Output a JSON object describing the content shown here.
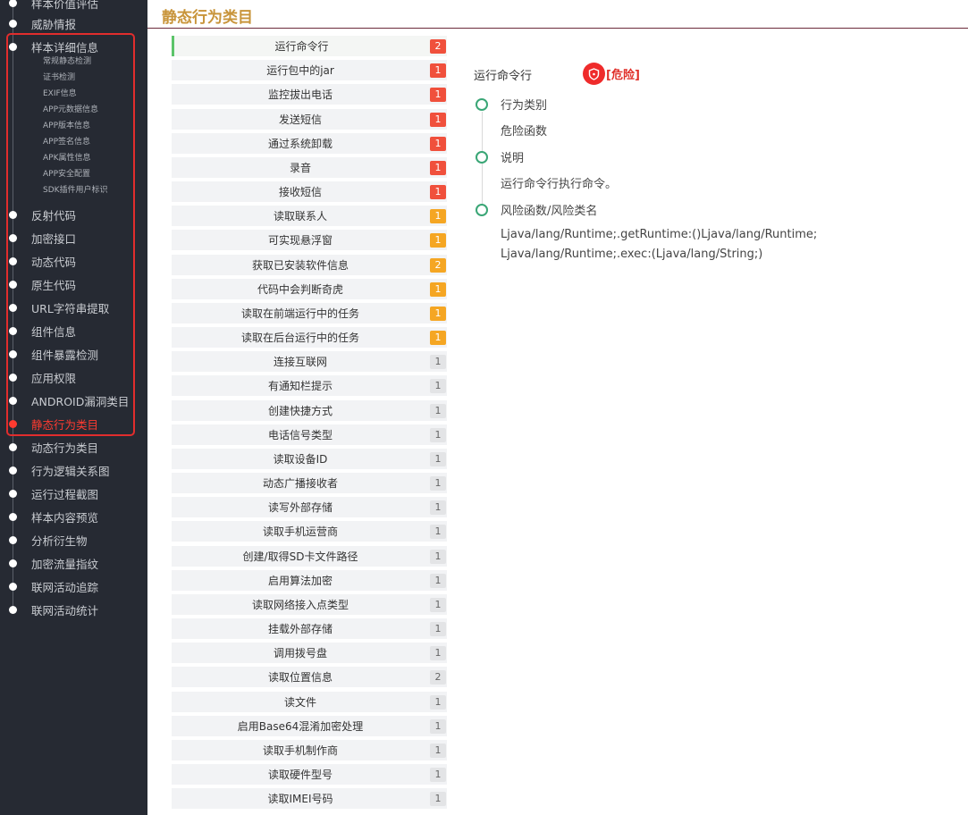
{
  "sidebar": {
    "items_top": [
      {
        "label": "样本价值评估"
      },
      {
        "label": "威胁情报"
      }
    ],
    "detail_group": {
      "label": "样本详细信息",
      "sub_items": [
        "常规静态检测",
        "证书检测",
        "EXIF信息",
        "APP元数据信息",
        "APP版本信息",
        "APP签名信息",
        "APK属性信息",
        "APP安全配置",
        "SDK插件用户标识"
      ]
    },
    "items_mid": [
      {
        "label": "反射代码"
      },
      {
        "label": "加密接口"
      },
      {
        "label": "动态代码"
      },
      {
        "label": "原生代码"
      },
      {
        "label": "URL字符串提取"
      },
      {
        "label": "组件信息"
      },
      {
        "label": "组件暴露检测"
      },
      {
        "label": "应用权限"
      },
      {
        "label": "ANDROID漏洞类目"
      },
      {
        "label": "静态行为类目"
      }
    ],
    "items_bottom": [
      {
        "label": "动态行为类目"
      },
      {
        "label": "行为逻辑关系图"
      },
      {
        "label": "运行过程截图"
      },
      {
        "label": "样本内容预览"
      },
      {
        "label": "分析衍生物"
      },
      {
        "label": "加密流量指纹"
      },
      {
        "label": "联网活动追踪"
      },
      {
        "label": "联网活动统计"
      }
    ],
    "active_label": "静态行为类目"
  },
  "page": {
    "title": "静态行为类目"
  },
  "categories": [
    {
      "label": "运行命令行",
      "count": "2",
      "level": "red"
    },
    {
      "label": "运行包中的jar",
      "count": "1",
      "level": "red"
    },
    {
      "label": "监控拔出电话",
      "count": "1",
      "level": "red"
    },
    {
      "label": "发送短信",
      "count": "1",
      "level": "red"
    },
    {
      "label": "通过系统卸载",
      "count": "1",
      "level": "red"
    },
    {
      "label": "录音",
      "count": "1",
      "level": "red"
    },
    {
      "label": "接收短信",
      "count": "1",
      "level": "red"
    },
    {
      "label": "读取联系人",
      "count": "1",
      "level": "orange"
    },
    {
      "label": "可实现悬浮窗",
      "count": "1",
      "level": "orange"
    },
    {
      "label": "获取已安装软件信息",
      "count": "2",
      "level": "orange"
    },
    {
      "label": "代码中会判断奇虎",
      "count": "1",
      "level": "orange"
    },
    {
      "label": "读取在前端运行中的任务",
      "count": "1",
      "level": "orange"
    },
    {
      "label": "读取在后台运行中的任务",
      "count": "1",
      "level": "orange"
    },
    {
      "label": "连接互联网",
      "count": "1",
      "level": "grey"
    },
    {
      "label": "有通知栏提示",
      "count": "1",
      "level": "grey"
    },
    {
      "label": "创建快捷方式",
      "count": "1",
      "level": "grey"
    },
    {
      "label": "电话信号类型",
      "count": "1",
      "level": "grey"
    },
    {
      "label": "读取设备ID",
      "count": "1",
      "level": "grey"
    },
    {
      "label": "动态广播接收者",
      "count": "1",
      "level": "grey"
    },
    {
      "label": "读写外部存储",
      "count": "1",
      "level": "grey"
    },
    {
      "label": "读取手机运营商",
      "count": "1",
      "level": "grey"
    },
    {
      "label": "创建/取得SD卡文件路径",
      "count": "1",
      "level": "grey"
    },
    {
      "label": "启用算法加密",
      "count": "1",
      "level": "grey"
    },
    {
      "label": "读取网络接入点类型",
      "count": "1",
      "level": "grey"
    },
    {
      "label": "挂载外部存储",
      "count": "1",
      "level": "grey"
    },
    {
      "label": "调用拨号盘",
      "count": "1",
      "level": "grey"
    },
    {
      "label": "读取位置信息",
      "count": "2",
      "level": "grey"
    },
    {
      "label": "读文件",
      "count": "1",
      "level": "grey"
    },
    {
      "label": "启用Base64混淆加密处理",
      "count": "1",
      "level": "grey"
    },
    {
      "label": "读取手机制作商",
      "count": "1",
      "level": "grey"
    },
    {
      "label": "读取硬件型号",
      "count": "1",
      "level": "grey"
    },
    {
      "label": "读取IMEI号码",
      "count": "1",
      "level": "grey"
    }
  ],
  "detail": {
    "title": "运行命令行",
    "danger_label": "[危险]",
    "fields": [
      {
        "heading": "行为类别",
        "value": "危险函数"
      },
      {
        "heading": "说明",
        "value": "运行命令行执行命令。"
      },
      {
        "heading": "风险函数/风险类名",
        "value_lines": [
          "Ljava/lang/Runtime;.getRuntime:()Ljava/lang/Runtime;",
          "Ljava/lang/Runtime;.exec:(Ljava/lang/String;)"
        ]
      }
    ]
  },
  "colors": {
    "sidebar_bg": "#262a33",
    "title_gold": "#c8943a",
    "active_red": "#ff3b30",
    "badge_red": "#f0503c",
    "badge_orange": "#f5a623",
    "timeline_green": "#3aa676"
  }
}
